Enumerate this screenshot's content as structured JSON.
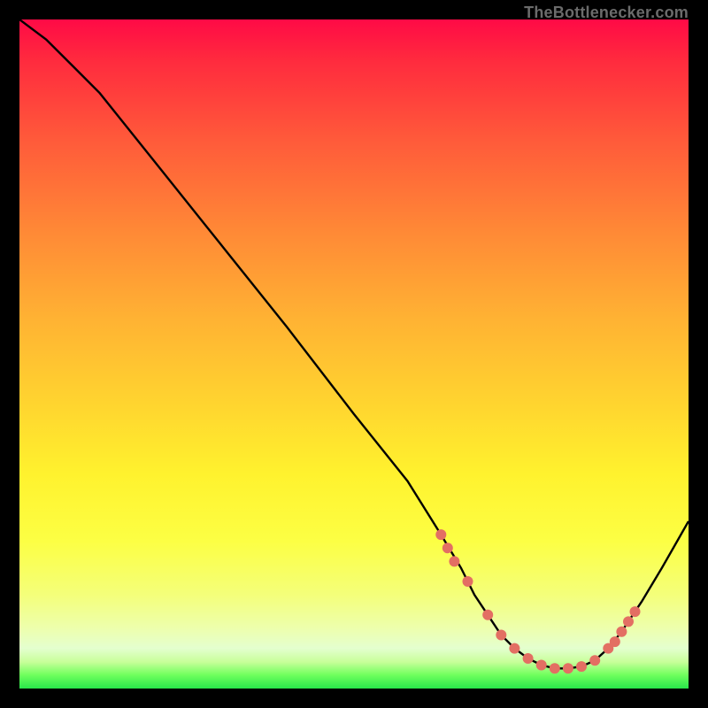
{
  "watermark": "TheBottlenecker.com",
  "colors": {
    "curve": "#000000",
    "marker": "#e36f63",
    "frame": "#000000"
  },
  "chart_data": {
    "type": "line",
    "title": "",
    "xlabel": "",
    "ylabel": "",
    "xlim": [
      0,
      100
    ],
    "ylim": [
      0,
      100
    ],
    "grid": false,
    "legend": false,
    "series": [
      {
        "name": "bottleneck-curve",
        "x": [
          0,
          4,
          8,
          12,
          20,
          30,
          40,
          50,
          58,
          63,
          66,
          68,
          70,
          72,
          74,
          76,
          78,
          80,
          82,
          84,
          86,
          88,
          90,
          93,
          96,
          100
        ],
        "y": [
          100,
          97,
          93,
          89,
          79,
          66.5,
          54,
          41,
          31,
          23,
          18,
          14,
          11,
          8,
          6,
          4.5,
          3.5,
          3,
          3,
          3.3,
          4.2,
          6,
          8.5,
          13,
          18,
          25
        ]
      }
    ],
    "markers": {
      "name": "highlight-points",
      "x": [
        63,
        64,
        65,
        67,
        70,
        72,
        74,
        76,
        78,
        80,
        82,
        84,
        86,
        88,
        89,
        90,
        91,
        92
      ],
      "y": [
        23,
        21,
        19,
        16,
        11,
        8,
        6,
        4.5,
        3.5,
        3,
        3,
        3.3,
        4.2,
        6,
        7,
        8.5,
        10,
        11.5
      ]
    }
  }
}
